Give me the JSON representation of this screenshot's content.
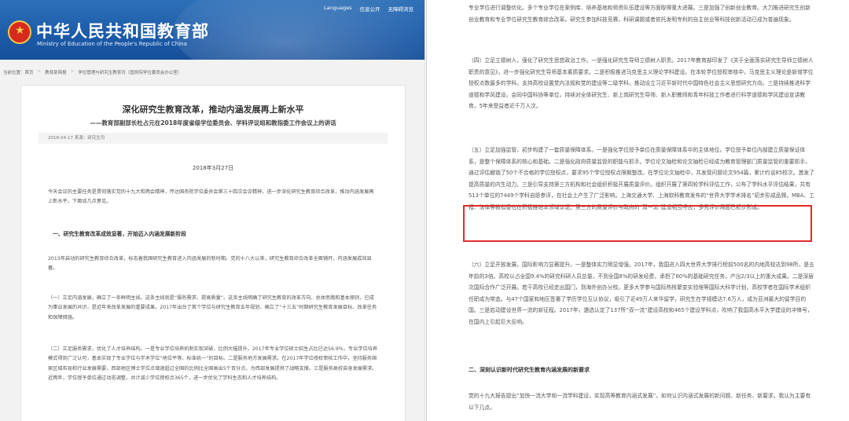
{
  "header": {
    "site_name": "中华人民共和国教育部",
    "site_name_en": "Ministry of Education of the People's Republic of China",
    "links": [
      "Languages",
      "信息公开",
      "无障碍浏览"
    ]
  },
  "breadcrumb": [
    "当前位置：首页",
    "教育部简报",
    "学位管理与研究生教育司（国务院学位委员会办公室）"
  ],
  "article": {
    "title": "深化研究生教育改革，推动内涵发展再上新水平",
    "subtitle": "——教育部副部长杜占元在2018年度省级学位委员会、学科评议组和教指委工作会议上的讲话",
    "meta": "2018-04-17    来源：研究生司",
    "date": "2018年3月27日",
    "left_paragraphs": [
      "今天会议的主要任务是贯彻落实党的十九大和两会精神，传达国务院学位委员会第三十四次会议精神，进一步深化研究生教育综合改革，推动内涵发展再上新水平。下面谈几点意见。",
      "2013年启动的研究生教育综合改革，标志着我国研究生教育进入内涵发展的新时期。党的十八大以来，研究生教育综合改革全面铺开，内涵发展成效显著。",
      "（一）立足内涵发展，确立了一条鲜明主线。这条主线就是“服务需求、提高质量”。这条主线明确了研究生教育的改革方向、总体思路和基本原则，已成为事业发展的共识，是近年来改革发展的重要成果。2017年出台了首个学位与研究生教育五年规划，确立了“十三五”时期研究生教育发展目标、改革任务和保障措施。",
      "（二）立足服务需求，优化了人才培养结构。一是专业学位培养机制实现突破，比例大幅提升。2017年专业学位硕士招生占比已达56.9%，专业学位培养模式得到广泛认可，基本实现了专业学位与学术学位“地位平等、标准统一”的目标。二是服务地方发展需求。在2017年学位授权审核工作中，坚持服务国家区域布局和行业发展需要，西部地区博士学位点增速超过全国的比例比全国高出5个百分点，为西部发展提供了战略支撑。三是服务高校自身发展需求。近两年，学位授予单位通过动态调整，共计减少学位授权点365个，进一步优化了学科生态和人才培养结构。"
    ],
    "left_heading": "一、研究生教育改革成效显著，开始迈入内涵发展新阶段",
    "right_paragraphs": [
      "专业学位进行调整优化。多个专业学位在案例库、培养基地和师资队伍建设等方面取得重大进展。三是加强了创新创业教育。大力推进研究生创新创业教育和专业学位研究生教育综合改革。研究生参加科技竞赛，科研课题或者依托发明专利的自主创业等科技创新活动已成为普遍现象。",
      "（四）立足立德树人，强化了研究生思想政治工作。一是强化研究生导师立德树人职责。2017年教育部印发了《关于全面落实研究生导师立德树人职责的意见》，进一步强化研究生导师基本素质要求。二是积极推进马克思主义理论学科建设。在本轮学位授权审核中，马克思主义理论是新增学位授权点数最多的学科。支持高校设置党内法规和党的建设等二级学科，推动设立习近平新时代中国特色社会主义思想研究方向。三是持续推进科学道德和学风建设。会同中国科协等单位，持续对全体研究生、新上岗研究生导师、新入职教师和青年科技工作者进行科学道德和学风建设宣讲教育，5年来受益者近千万人次。",
      "（五）立足加强监管，初步构建了一套质量保障体系。一是强化学位授予单位在质量保障体系中的主体地位。学位授予单位内部建立质量保证体系，是整个保障体系的核心和基础。二是强化政府质量监管的职能与抓手。学位论文抽检和论文抽检已经成为教育管理部门质量监管的重要抓手。通过评估撤销了50个不合格的学位授权点，要求95个学位授权点限期整改。在学位论文抽检中，共发现问题论文954篇，累计约谈85校次。激发了提高质量的内生动力。三是引导支持第三方机构和社会组织积极开展质量评价。组织开展了第四轮学科评估工作，公布了学科水平评估结果，共有513个单位的7449个学科自愿参评，在社会上产生了广泛影响。上海交通大学、上海软科教育发布的“世界大学学术排名”初步形成品牌。MBA、工程、法律等教指委也在积极推进本领域认证。第三方的质量评价与政府的“双一流”建设相互呼应，多元评价局面已初步形成。",
      "（六）立足开放发展，国际影响力显著提升。一是整体实力明显增强。2017年，我国进入四大世界大学排行榜前500名的内地高校达到98所，是五年前的3倍。高校以占全国9.4%的研究科研人员总量，不到全国8%的研发经费，承担了60%的基础研究任务，产出2/3以上的重大成果。二是深层次国际合作广泛开展。若干高校已经走出国门，到海外创办分校。更多大学参与国际热核聚变实验堆等国际大科学计划，高校学者在国际学术组织任职成为常态。与47个国家和地区签署了学历学位互认协议，吸引了近49万人来华留学，研究生在学规模达7.6万人，成为亚洲最大的留学目的国。三是启动建设世界一流的新征程。2017年，遴选认定了137所“双一流”建设高校和465个建设学科点，吹响了我国高水平大学建设的冲锋号，在国内上引起巨大反响。",
      "党的十九大报告提出“加快一流大学和一流学科建设，实现高等教育内涵式发展”。如何认识内涵式发展的新问题、新任务、新要求，我认为主要有以下几点。"
    ],
    "right_heading": "二、深刻认识新时代研究生教育内涵发展的新要求"
  },
  "colors": {
    "header_blue": "#1b5aa8",
    "highlight_red": "#e02b2b"
  }
}
